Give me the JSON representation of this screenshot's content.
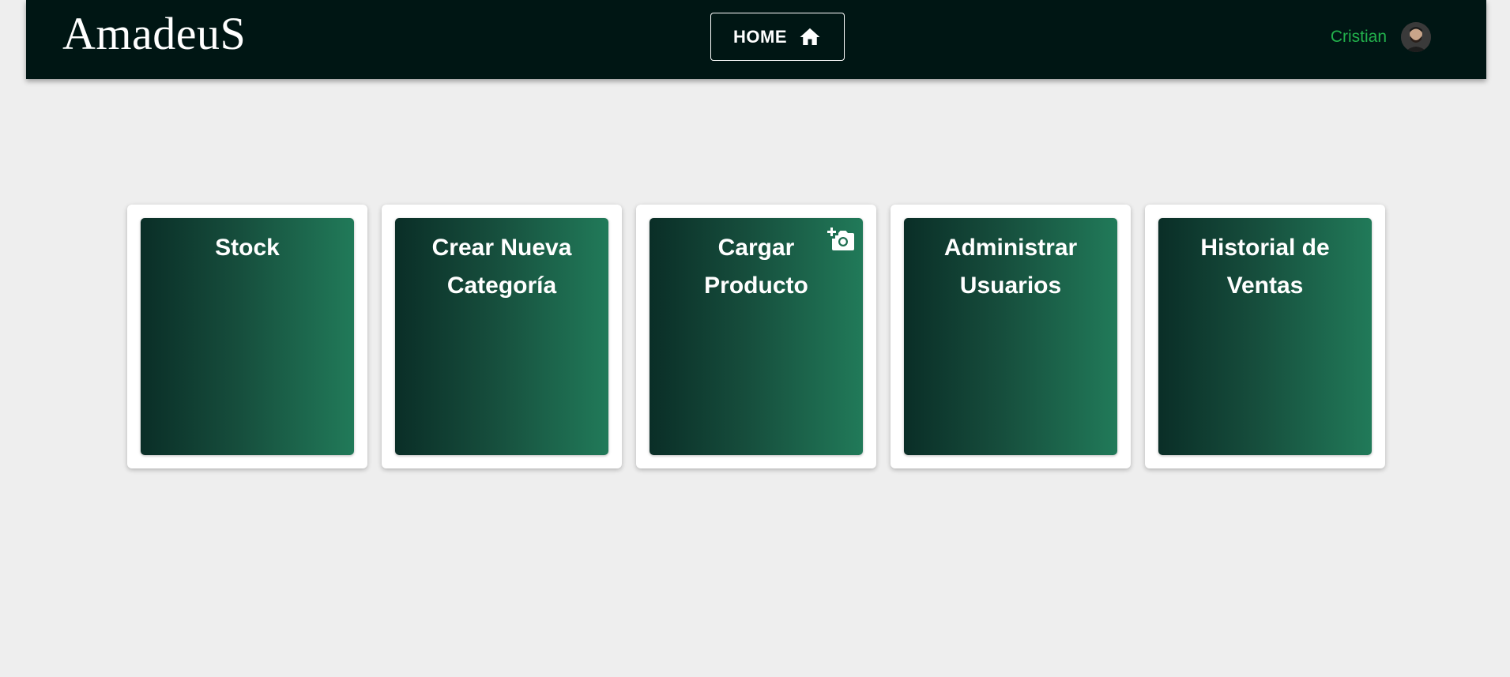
{
  "header": {
    "brand": "AmadeuS",
    "home_label": "HOME",
    "user_name": "Cristian"
  },
  "cards": [
    {
      "title": "Stock"
    },
    {
      "title": "Crear Nueva Categoría"
    },
    {
      "title": "Cargar Producto",
      "icon": "add-photo-icon"
    },
    {
      "title": "Administrar Usuarios"
    },
    {
      "title": "Historial de Ventas"
    }
  ],
  "colors": {
    "navbar": "#001614",
    "accent_user": "#22b14c",
    "card_gradient_start": "#0a2e27",
    "card_gradient_end": "#217a59",
    "page_background": "#eeeeee"
  }
}
